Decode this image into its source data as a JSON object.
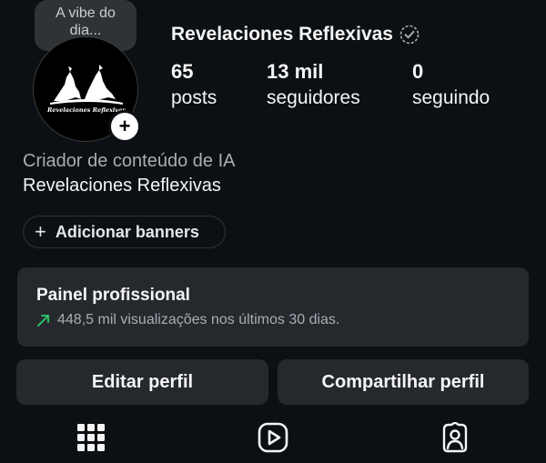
{
  "note": {
    "text": "A vibe do dia..."
  },
  "profile": {
    "username": "Revelaciones Reflexivas",
    "avatar_text": "Revelaciones Reflexivas",
    "category": "Criador de conteúdo de IA",
    "display_name": "Revelaciones Reflexivas"
  },
  "stats": [
    {
      "value": "65",
      "label": "posts"
    },
    {
      "value": "13 mil",
      "label": "seguidores"
    },
    {
      "value": "0",
      "label": "seguindo"
    }
  ],
  "banner_button": {
    "label": "Adicionar banners"
  },
  "dashboard": {
    "title": "Painel profissional",
    "subtitle": "448,5 mil visualizações nos últimos 30 dias."
  },
  "actions": {
    "edit_label": "Editar perfil",
    "share_label": "Compartilhar perfil"
  },
  "tabs": [
    {
      "icon": "grid-icon"
    },
    {
      "icon": "reels-icon"
    },
    {
      "icon": "tagged-icon"
    }
  ],
  "colors": {
    "background": "#0c1014",
    "card": "#25292e",
    "trend": "#2dcf6c"
  }
}
